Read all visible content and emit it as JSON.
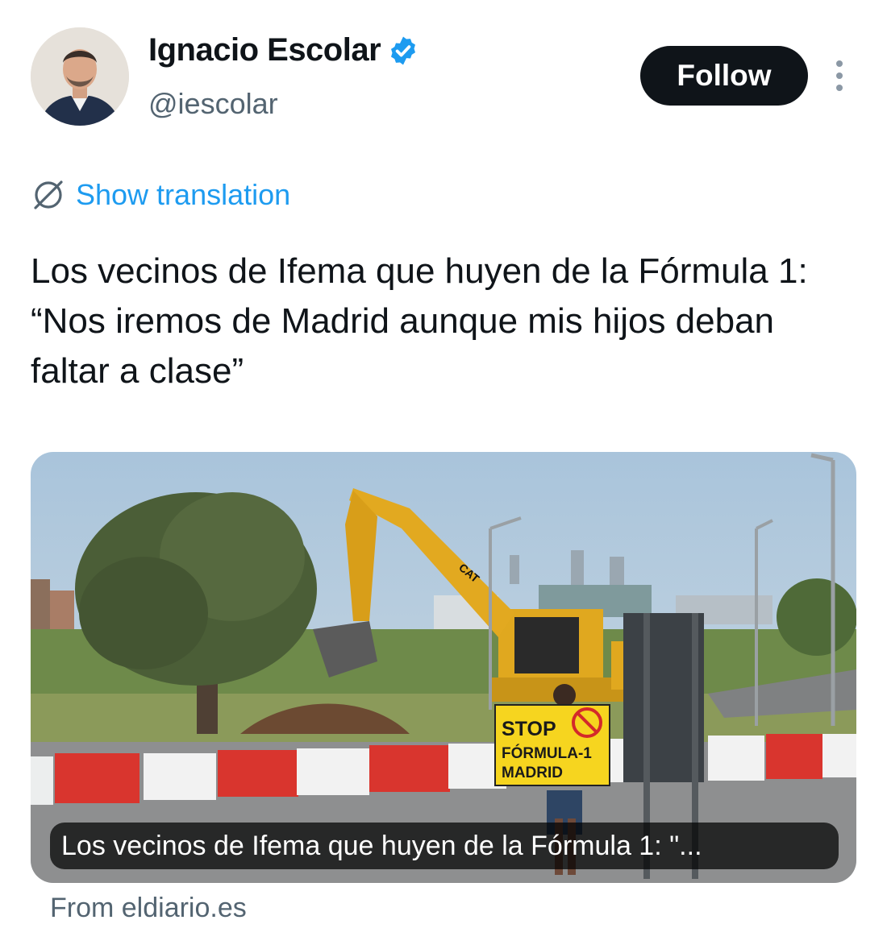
{
  "author": {
    "display_name": "Ignacio Escolar",
    "handle": "@iescolar",
    "verified": true,
    "avatar_icon": "profile-photo"
  },
  "actions": {
    "follow_label": "Follow",
    "more_icon": "more-vertical-icon"
  },
  "translation": {
    "label": "Show translation",
    "icon": "globe-slash-icon"
  },
  "tweet": {
    "text": "Los vecinos de Ifema que huyen de la Fórmula 1: “Nos iremos de Madrid aunque mis hijos deban faltar a clase”"
  },
  "link_card": {
    "caption": "Los vecinos de Ifema que huyen de la Fórmula 1: \"...",
    "source": "From eldiario.es",
    "image": {
      "sign_lines": [
        "STOP",
        "FÓRMULA-1",
        "MADRID"
      ],
      "excavator_brand": "CAT"
    }
  },
  "colors": {
    "link_blue": "#1d9bf0",
    "verified_blue": "#1d9bf0",
    "text_primary": "#0f1419",
    "text_secondary": "#536471",
    "follow_bg": "#0f1419"
  }
}
